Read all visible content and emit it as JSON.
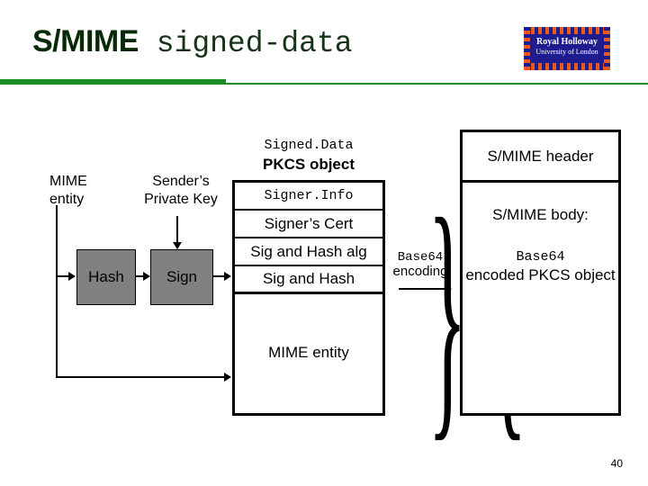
{
  "slide": {
    "title_sans": "S/MIME",
    "title_mono": " signed-data",
    "page_number": "40",
    "accent_green": "#1a8d25",
    "title_color": "#062906",
    "process_box_fill": "#808080"
  },
  "logo": {
    "line1": "Royal Holloway",
    "line2": "University of London",
    "background": "#1d1d8f",
    "border_color": "#e8591f"
  },
  "diagram": {
    "input_label": "MIME\nentity",
    "key_label": "Sender’s\nPrivate Key",
    "hash_box": "Hash",
    "sign_box": "Sign",
    "pkcs": {
      "caption_mono": "Signed.Data",
      "caption_sans": "PKCS object",
      "rows": [
        {
          "text": "Signer.Info",
          "style": "mono"
        },
        {
          "text": "Signer’s Cert",
          "style": "sans"
        },
        {
          "text": "Sig and Hash alg",
          "style": "sans"
        },
        {
          "text": "Sig and Hash",
          "style": "sans"
        }
      ],
      "body": "MIME entity"
    },
    "encoding": {
      "label_mono": "Base64",
      "label_sans": "encoding",
      "left_brace": "}",
      "right_brace": "{"
    },
    "smime": {
      "header": "S/MIME header",
      "body_title": "S/MIME body:",
      "body_mono": "Base64",
      "body_sans": "encoded PKCS\nobject"
    }
  }
}
